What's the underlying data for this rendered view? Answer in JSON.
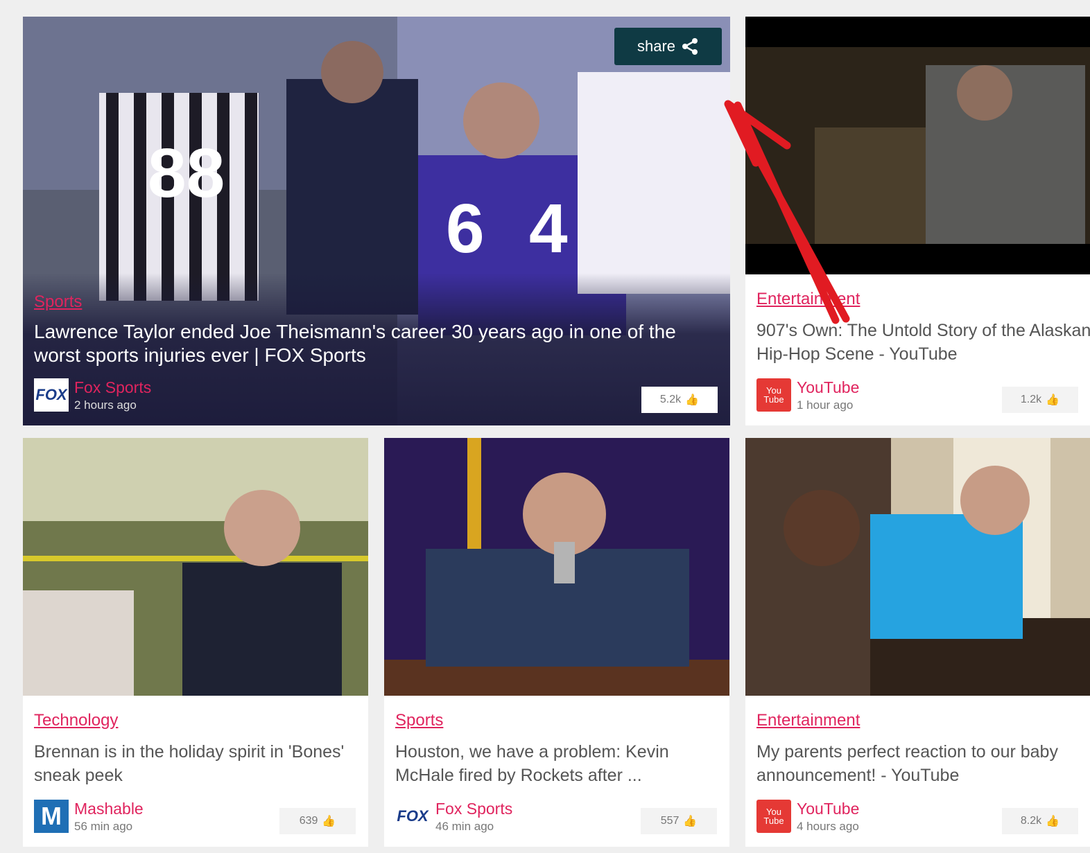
{
  "feature": {
    "category": "Sports",
    "title": "Lawrence Taylor ended Joe Theismann's career 30 years ago in one of the worst sports injuries ever | FOX Sports",
    "source": "Fox Sports",
    "time": "2 hours ago",
    "likes": "5.2k",
    "share_label": "share",
    "logo_text": "FOX"
  },
  "cards": [
    {
      "category": "Entertainment",
      "title": "907's Own: The Untold Story of the Alaskan Hip-Hop Scene - YouTube",
      "source": "YouTube",
      "time": "1 hour ago",
      "likes": "1.2k",
      "logo_text": "You Tube"
    },
    {
      "category": "Technology",
      "title": "Brennan is in the holiday spirit in 'Bones' sneak peek",
      "source": "Mashable",
      "time": "56 min ago",
      "likes": "639",
      "logo_text": "M"
    },
    {
      "category": "Sports",
      "title": "Houston, we have a problem: Kevin McHale fired by Rockets after ...",
      "source": "Fox Sports",
      "time": "46 min ago",
      "likes": "557",
      "logo_text": "FOX"
    },
    {
      "category": "Entertainment",
      "title": "My parents perfect reaction to our baby announcement! - YouTube",
      "source": "YouTube",
      "time": "4 hours ago",
      "likes": "8.2k",
      "logo_text": "You Tube"
    }
  ],
  "colors": {
    "accent": "#e0245e",
    "share_bg": "#0f3a44",
    "annotation_arrow": "#e11b22"
  },
  "icons": {
    "share": "share-icon",
    "like": "thumbs-up-icon"
  }
}
